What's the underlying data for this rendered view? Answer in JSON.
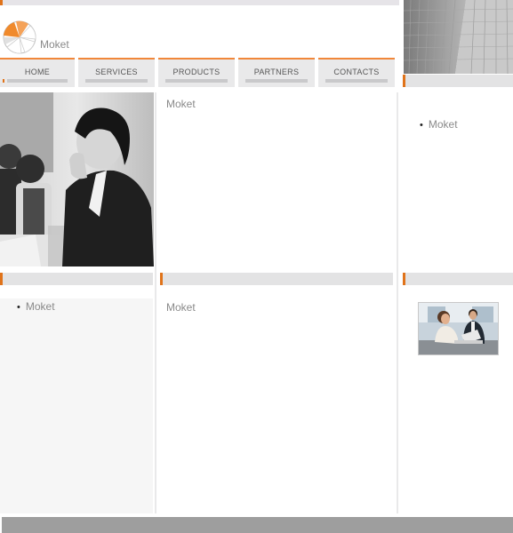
{
  "brand": {
    "name": "Moket"
  },
  "nav": {
    "items": [
      {
        "label": "HOME"
      },
      {
        "label": "SERVICES"
      },
      {
        "label": "PRODUCTS"
      },
      {
        "label": "PARTNERS"
      },
      {
        "label": "CONTACTS"
      }
    ]
  },
  "panels": {
    "center_top_heading": "Moket",
    "right_top_item": "Moket",
    "left_bottom_item": "Moket",
    "center_bottom_heading": "Moket"
  },
  "colors": {
    "accent": "#e0731a",
    "nav_bg": "#e9e9ea",
    "bar_bg": "#e3e3e4",
    "text_muted": "#8a8a8a",
    "footer": "#9e9e9e"
  }
}
